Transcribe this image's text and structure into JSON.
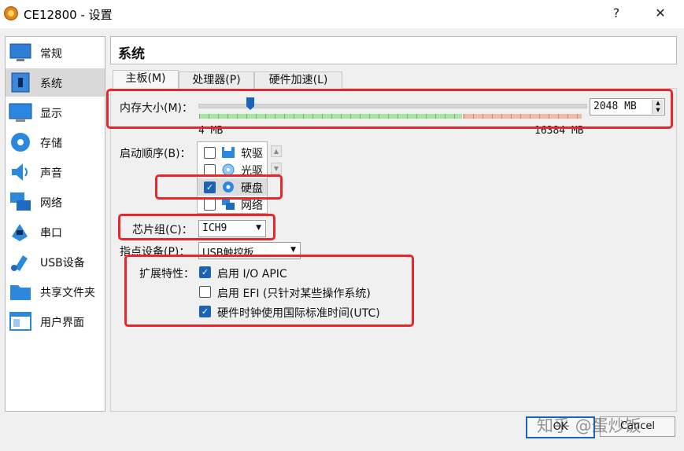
{
  "window": {
    "title": "CE12800 - 设置",
    "help_glyph": "?",
    "close_glyph": "✕"
  },
  "sidebar": {
    "items": [
      {
        "label": "常规",
        "icon": "general-icon"
      },
      {
        "label": "系统",
        "icon": "system-icon",
        "selected": true
      },
      {
        "label": "显示",
        "icon": "display-icon"
      },
      {
        "label": "存储",
        "icon": "storage-icon"
      },
      {
        "label": "声音",
        "icon": "audio-icon"
      },
      {
        "label": "网络",
        "icon": "network-icon"
      },
      {
        "label": "串口",
        "icon": "serial-port-icon"
      },
      {
        "label": "USB设备",
        "icon": "usb-icon"
      },
      {
        "label": "共享文件夹",
        "icon": "shared-folder-icon"
      },
      {
        "label": "用户界面",
        "icon": "user-interface-icon"
      }
    ]
  },
  "header": {
    "title": "系统"
  },
  "tabs": [
    {
      "label": "主板(M)",
      "active": true
    },
    {
      "label": "处理器(P)"
    },
    {
      "label": "硬件加速(L)"
    }
  ],
  "motherboard": {
    "memory": {
      "label": "内存大小(M)：",
      "value": "2048 MB",
      "min_label": "4 MB",
      "max_label": "16384 MB"
    },
    "boot_order": {
      "label": "启动顺序(B)：",
      "items": [
        {
          "label": "软驱",
          "checked": false,
          "icon": "floppy-icon"
        },
        {
          "label": "光驱",
          "checked": false,
          "icon": "optical-disc-icon"
        },
        {
          "label": "硬盘",
          "checked": true,
          "icon": "hard-disk-icon"
        },
        {
          "label": "网络",
          "checked": false,
          "icon": "network-boot-icon"
        }
      ]
    },
    "chipset": {
      "label": "芯片组(C)：",
      "value": "ICH9"
    },
    "pointing_device": {
      "label": "指点设备(P)：",
      "value": "USB触控板"
    },
    "extended_features": {
      "label": "扩展特性：",
      "options": [
        {
          "label": "启用 I/O APIC",
          "checked": true
        },
        {
          "label": "启用 EFI (只针对某些操作系统)",
          "checked": false
        },
        {
          "label": "硬件时钟使用国际标准时间(UTC)",
          "checked": true
        }
      ]
    }
  },
  "buttons": {
    "ok": "OK",
    "cancel": "Cancel"
  },
  "watermark": "知乎 @蛋炒饭",
  "colors": {
    "accent": "#1a63b8",
    "highlight": "#e8262b"
  }
}
